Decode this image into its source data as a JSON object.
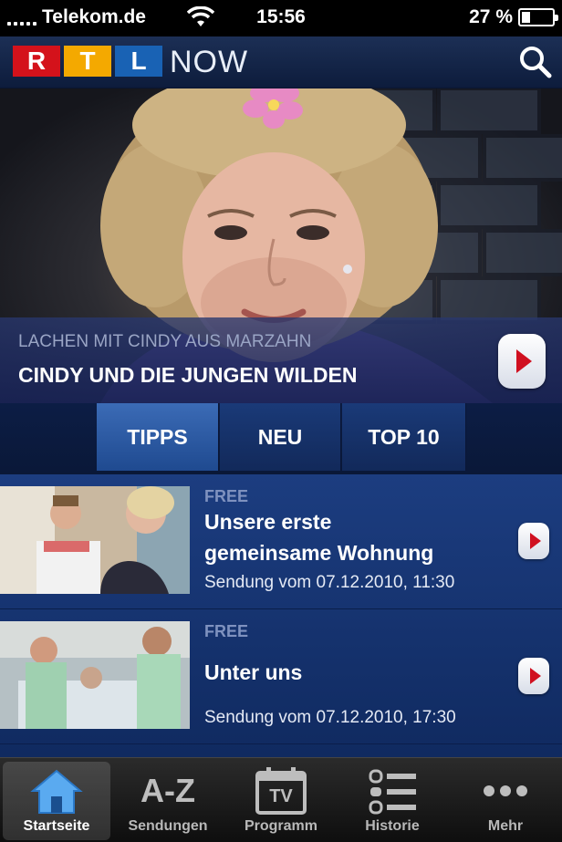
{
  "status_bar": {
    "carrier": "Telekom.de",
    "time": "15:56",
    "battery": "27 %",
    "battery_level": 0.27
  },
  "header": {
    "logo_letters": [
      "R",
      "T",
      "L"
    ],
    "logo_suffix": "NOW",
    "search_icon": "search-icon"
  },
  "hero": {
    "subtitle": "LACHEN MIT CINDY AUS MARZAHN",
    "title": "CINDY UND DIE JUNGEN WILDEN",
    "play_icon": "play-icon"
  },
  "tabs": [
    {
      "label": "TIPPS",
      "active": true
    },
    {
      "label": "NEU",
      "active": false
    },
    {
      "label": "TOP 10",
      "active": false
    }
  ],
  "episodes": [
    {
      "badge": "FREE",
      "title_line1": "Unsere erste",
      "title_line2": "gemeinsame Wohnung",
      "date": "Sendung vom 07.12.2010, 11:30"
    },
    {
      "badge": "FREE",
      "title_line1": "Unter uns",
      "title_line2": "",
      "date": "Sendung vom 07.12.2010, 17:30"
    }
  ],
  "bottom_tabs": [
    {
      "label": "Startseite",
      "icon": "home-icon",
      "active": true
    },
    {
      "label": "Sendungen",
      "icon": "a-z-icon",
      "icon_text": "A-Z",
      "active": false
    },
    {
      "label": "Programm",
      "icon": "tv-calendar-icon",
      "icon_text": "TV",
      "active": false
    },
    {
      "label": "Historie",
      "icon": "list-icon",
      "active": false
    },
    {
      "label": "Mehr",
      "icon": "more-icon",
      "active": false
    }
  ],
  "colors": {
    "rtl_red": "#d4121b",
    "rtl_yellow": "#f4a900",
    "rtl_blue": "#1962b4",
    "play_red": "#d01020"
  }
}
